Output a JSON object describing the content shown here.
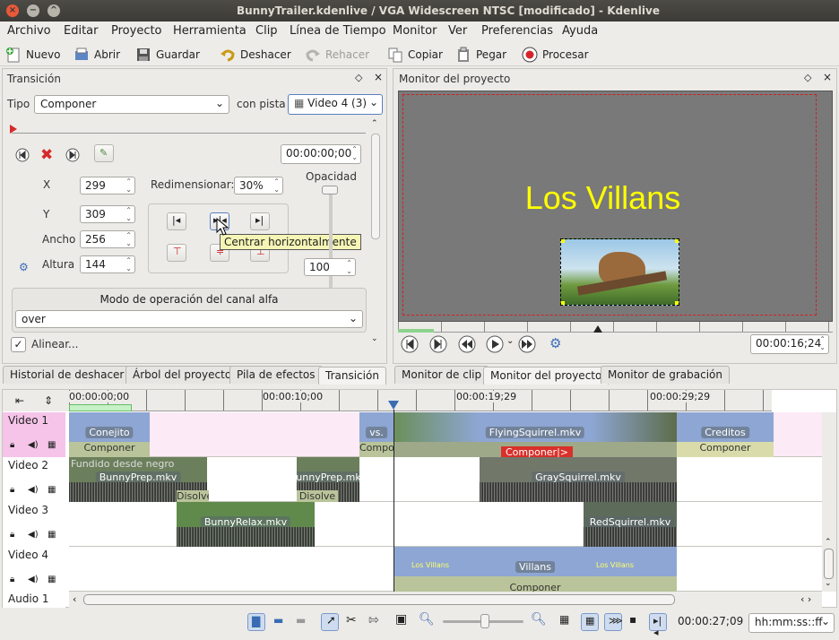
{
  "window": {
    "title": "BunnyTrailer.kdenlive / VGA Widescreen NTSC [modificado] - Kdenlive"
  },
  "menu": [
    "Archivo",
    "Editar",
    "Proyecto",
    "Herramienta",
    "Clip",
    "Línea de Tiempo",
    "Monitor",
    "Ver",
    "Preferencias",
    "Ayuda"
  ],
  "toolbar": {
    "nuevo": "Nuevo",
    "abrir": "Abrir",
    "guardar": "Guardar",
    "deshacer": "Deshacer",
    "rehacer": "Rehacer",
    "copiar": "Copiar",
    "pegar": "Pegar",
    "procesar": "Procesar"
  },
  "transition_panel": {
    "title": "Transición",
    "tipo_label": "Tipo",
    "tipo_value": "Componer",
    "pista_label": "con pista",
    "pista_value": "Video 4 (3)",
    "timecode": "00:00:00;00",
    "x_label": "X",
    "x_value": "299",
    "y_label": "Y",
    "y_value": "309",
    "ancho_label": "Ancho",
    "ancho_value": "256",
    "altura_label": "Altura",
    "altura_value": "144",
    "redim_label": "Redimensionar:",
    "redim_value": "30%",
    "opacidad_label": "Opacidad",
    "opacidad_value": "100",
    "tooltip": "Centrar horizontalmente",
    "alpha_label": "Modo de operación del canal alfa",
    "alpha_value": "over",
    "alinear_label": "Alinear..."
  },
  "monitor_panel": {
    "title": "Monitor del proyecto",
    "overlay_text": "Los Villans",
    "timecode": "00:00:16;24"
  },
  "left_tabs": [
    "Historial de deshacer",
    "Árbol del proyecto",
    "Pila de efectos",
    "Transición"
  ],
  "right_tabs": [
    "Monitor de clip",
    "Monitor del proyecto",
    "Monitor de grabación"
  ],
  "timeline": {
    "ruler": [
      "00:00:00;00",
      "00:00:10;00",
      "00:00:19;29",
      "00:00:29;29"
    ],
    "tracks": [
      "Video 1",
      "Video 2",
      "Video 3",
      "Video 4",
      "Audio 1"
    ],
    "clips": {
      "conejito": "Conejito",
      "vs": "vs.",
      "flying": "FlyingSquirrel.mkv",
      "creditos": "Creditos",
      "componer": "Componer",
      "fundido": "Fundido desde negro",
      "componer_red": "Componer|>",
      "bunnyprep1": "BunnyPrep.mkv",
      "bunnyprep2": "BunnyPrep.mkv",
      "disolve1": "Disolve",
      "disolve2": "Disolve",
      "gray": "GraySquirrel.mkv",
      "bunnyrelax": "BunnyRelax.mkv",
      "red": "RedSquirrel.mkv",
      "villans": "Villans",
      "los_villans_small": "Los Villans"
    }
  },
  "status": {
    "timecode": "00:00:27;09",
    "format": "hh:mm:ss::ff"
  },
  "colors": {
    "title_yellow": "#ffff00",
    "clip_blue": "#8ea6d3",
    "trans_green": "#b9c49a",
    "red_trans": "#d9302a"
  }
}
